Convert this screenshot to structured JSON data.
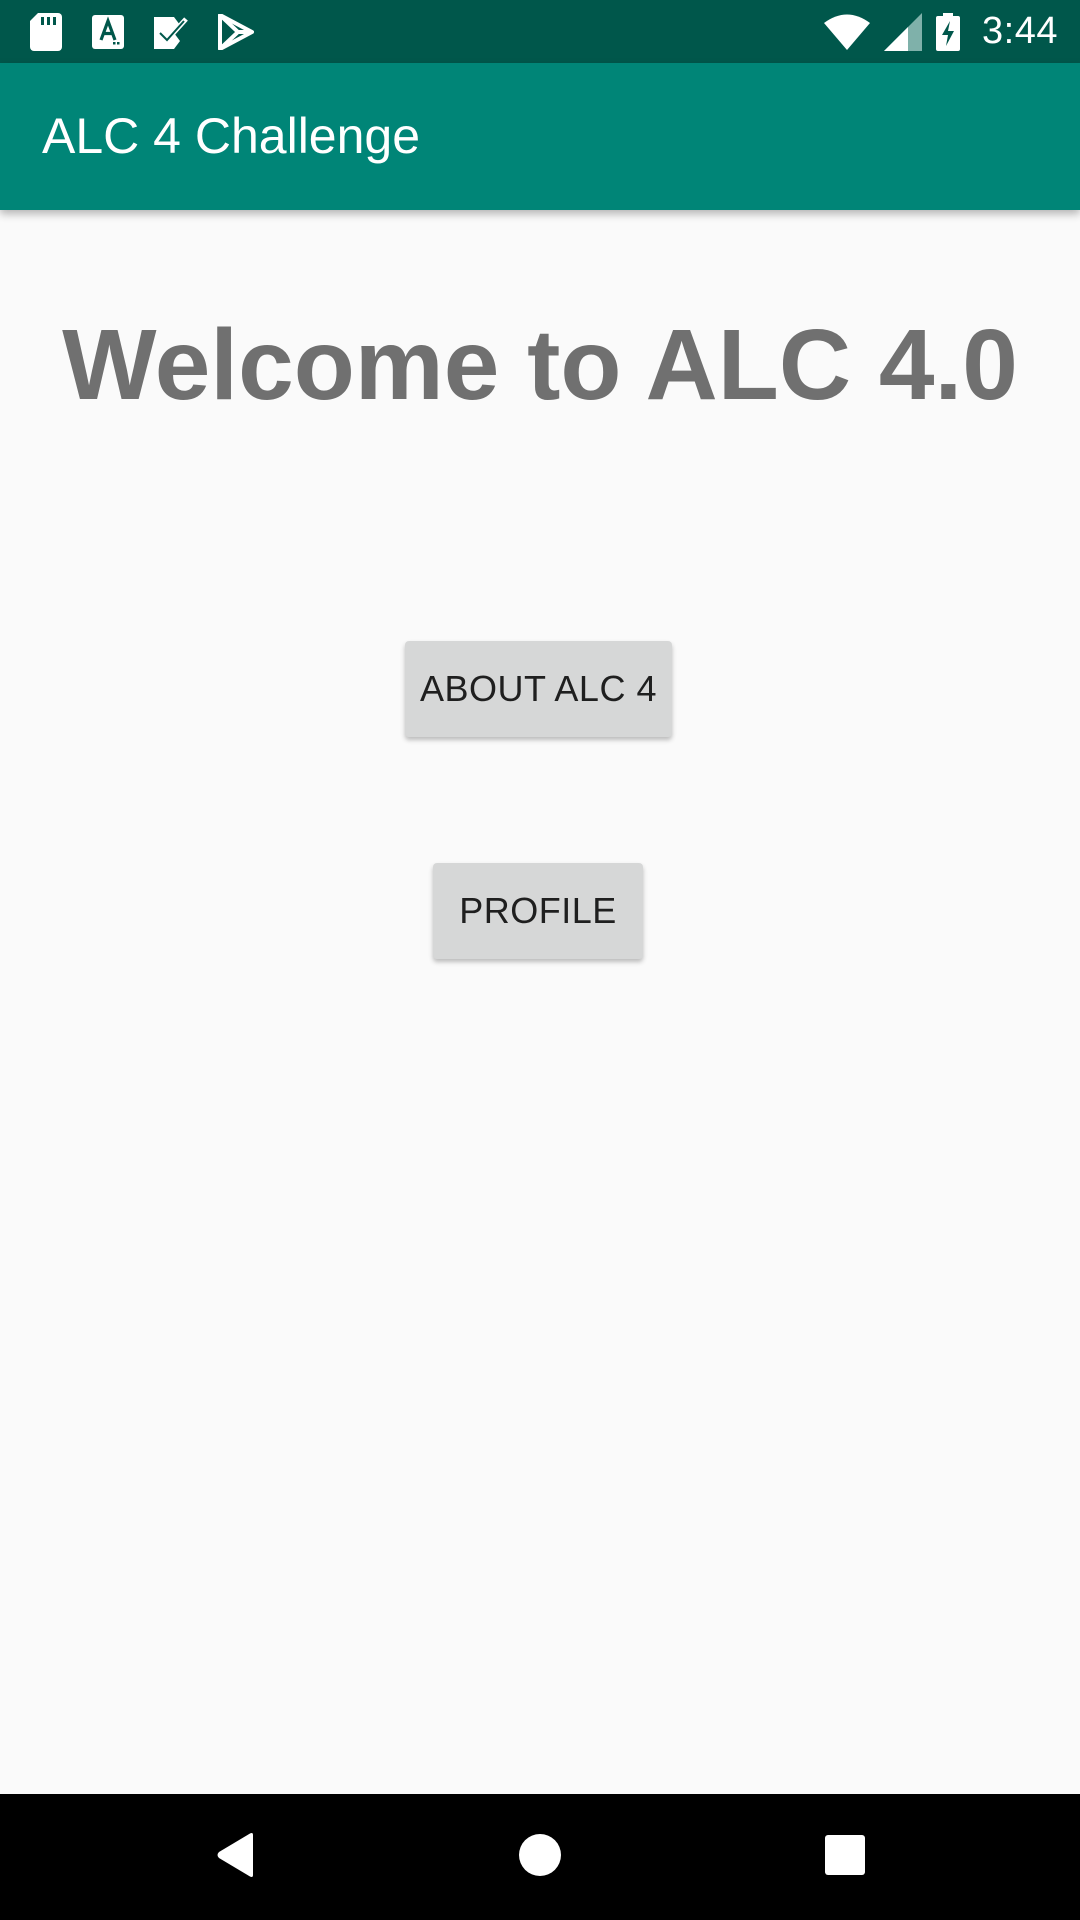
{
  "status_bar": {
    "time": "3:44",
    "background": "#00574b",
    "left_icons": [
      "sd-card-icon",
      "font-download-icon",
      "task-check-icon",
      "play-store-icon"
    ],
    "right_icons": [
      "wifi-icon",
      "cellular-signal-icon",
      "battery-charging-icon"
    ]
  },
  "app_bar": {
    "title": "ALC 4 Challenge",
    "background": "#008577"
  },
  "main": {
    "welcome_text": "Welcome to ALC 4.0",
    "buttons": {
      "about_label": "ABOUT ALC 4",
      "profile_label": "PROFILE"
    }
  },
  "nav_bar": {
    "icons": [
      "back-icon",
      "home-icon",
      "recents-icon"
    ]
  }
}
